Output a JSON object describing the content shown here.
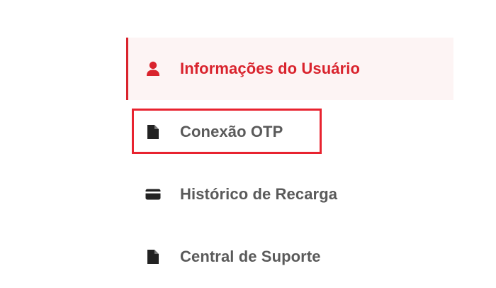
{
  "menu": {
    "items": [
      {
        "label": "Informações do Usuário",
        "icon": "user-icon",
        "active": true
      },
      {
        "label": "Conexão OTP",
        "icon": "document-icon",
        "active": false
      },
      {
        "label": "Histórico de Recarga",
        "icon": "credit-card-icon",
        "active": false
      },
      {
        "label": "Central de Suporte",
        "icon": "document-icon",
        "active": false
      }
    ]
  },
  "colors": {
    "accent": "#d9232d",
    "active_background": "#fdf4f4",
    "text": "#5a5a5a",
    "icon": "#222222",
    "highlight_box": "#e8232f"
  }
}
